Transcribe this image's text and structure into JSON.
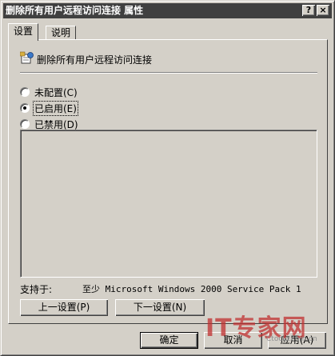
{
  "window": {
    "title": "删除所有用户远程访问连接 属性",
    "help_button": "?",
    "close_button": "×"
  },
  "tabs": [
    {
      "label": "设置",
      "active": true
    },
    {
      "label": "说明",
      "active": false
    }
  ],
  "policy": {
    "name": "删除所有用户远程访问连接",
    "icon": "policy-setting-icon"
  },
  "options": {
    "not_configured": "未配置(C)",
    "enabled": "已启用(E)",
    "disabled": "已禁用(D)",
    "selected": "enabled"
  },
  "supported": {
    "label": "支持于:",
    "value": "至少 Microsoft Windows 2000 Service Pack 1"
  },
  "nav": {
    "prev": "上一设置(P)",
    "next": "下一设置(N)"
  },
  "buttons": {
    "ok": "确定",
    "cancel": "取消",
    "apply": "应用(A)"
  },
  "watermark": {
    "text": "IT专家网",
    "sub": "Ctocio.com.cn"
  }
}
